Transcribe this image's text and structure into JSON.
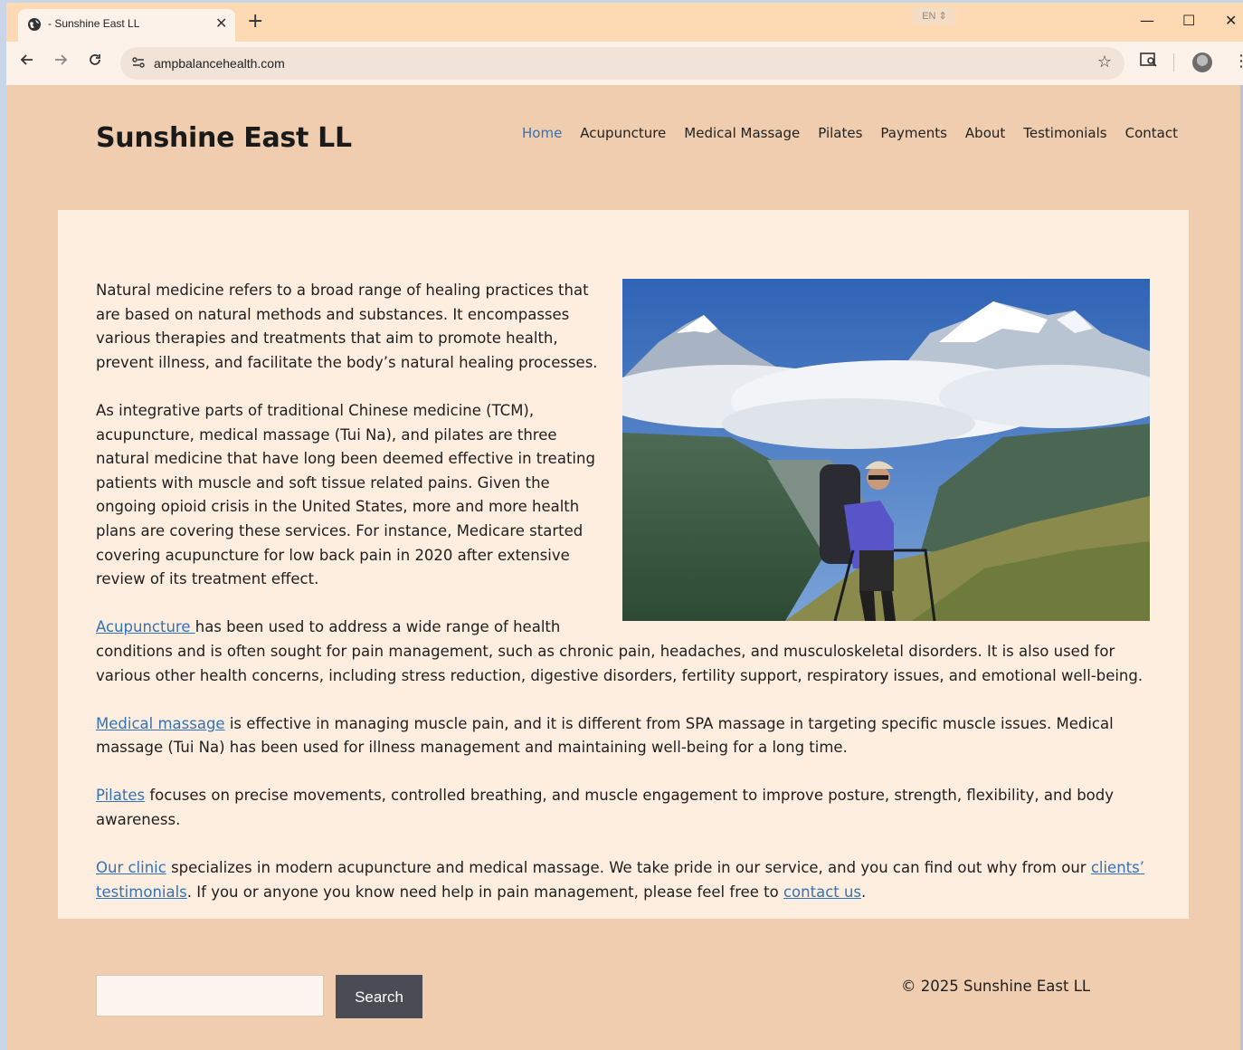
{
  "browser": {
    "tab_title": "- Sunshine East LL",
    "tab_close": "✕",
    "new_tab": "+",
    "language": "EN ⇕",
    "url": "ampbalancehealth.com",
    "min": "—",
    "max": "☐",
    "close": "✕",
    "icons": {
      "back": "back-arrow-icon",
      "forward": "forward-arrow-icon",
      "reload": "reload-icon",
      "site_info": "site-settings-icon",
      "bookmark": "star-icon",
      "reader": "reading-mode-icon",
      "profile": "avatar",
      "menu": "kebab-menu-icon"
    }
  },
  "site": {
    "title": "Sunshine East LL",
    "nav": [
      {
        "label": "Home",
        "active": true
      },
      {
        "label": "Acupuncture"
      },
      {
        "label": "Medical Massage"
      },
      {
        "label": "Pilates"
      },
      {
        "label": "Payments"
      },
      {
        "label": "About"
      },
      {
        "label": "Testimonials"
      },
      {
        "label": "Contact"
      }
    ]
  },
  "article": {
    "p1": "Natural medicine refers to a broad range of healing practices that are based on natural methods and substances. It encompasses various therapies and treatments that aim to promote health, prevent illness, and facilitate the body’s natural healing processes.",
    "p2": "As integrative parts of traditional Chinese medicine (TCM), acupuncture, medical massage (Tui Na), and pilates are three natural medicine that have long been deemed effective in treating patients with muscle and soft tissue related pains. Given the ongoing opioid crisis in the United States, more and more health plans are covering these services. For instance, Medicare started covering acupuncture for low back pain in 2020 after extensive review of its treatment effect.",
    "p3_link": "Acupuncture ",
    "p3_text": "has been used to address a wide range of health conditions and is often sought for pain management, such as chronic pain, headaches, and musculoskeletal disorders. It is also used for various other health concerns, including stress reduction, digestive disorders, fertility support, respiratory issues, and emotional well-being.",
    "p4_link": "Medical massage",
    "p4_text": " is effective in managing muscle pain, and it is different from SPA massage in targeting specific muscle issues. Medical massage (Tui Na) has been used for illness management and maintaining well-being for a long time.",
    "p5_link": "Pilates",
    "p5_text": " focuses on precise movements, controlled breathing, and muscle engagement to improve posture, strength, flexibility, and body awareness.",
    "p6_link1": "Our clinic",
    "p6_text1": " specializes in modern acupuncture and medical massage. We take pride in our service, and you can find out why from our ",
    "p6_link2": "clients’ testimonials",
    "p6_text2": ". If you or anyone you know need help in pain management, please feel free to ",
    "p6_link3": "contact us",
    "p6_text3": ".",
    "image_alt": "hiker-on-mountain-photo"
  },
  "footer": {
    "search_placeholder": "",
    "search_button": "Search",
    "copyright": "© 2025 Sunshine East LL"
  },
  "colors": {
    "page_bg": "#efcdae",
    "content_bg": "#fdeedf",
    "link": "#3571b5",
    "button_bg": "#4a4c55",
    "chrome_bg": "#fdd9b4"
  }
}
